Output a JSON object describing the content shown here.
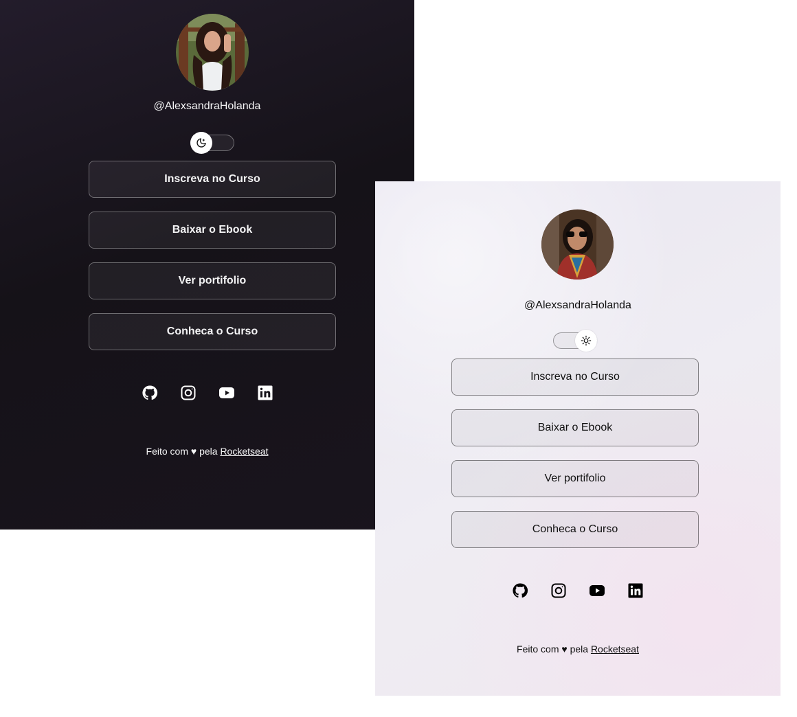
{
  "colors": {
    "dark_bg": "#151218",
    "light_bg": "#ecebf2",
    "dark_text": "#f4f4f5",
    "light_text": "#111111"
  },
  "dark": {
    "handle": "@AlexsandraHolanda",
    "theme_icon": "moon-icon",
    "links": [
      "Inscreva no Curso",
      "Baixar o Ebook",
      "Ver portifolio",
      "Conheca o Curso"
    ],
    "socials": [
      "github-icon",
      "instagram-icon",
      "youtube-icon",
      "linkedin-icon"
    ],
    "footer": {
      "prefix": "Feito com ♥ pela ",
      "link": "Rocketseat"
    }
  },
  "light": {
    "handle": "@AlexsandraHolanda",
    "theme_icon": "sun-icon",
    "links": [
      "Inscreva no Curso",
      "Baixar o Ebook",
      "Ver portifolio",
      "Conheca o Curso"
    ],
    "socials": [
      "github-icon",
      "instagram-icon",
      "youtube-icon",
      "linkedin-icon"
    ],
    "footer": {
      "prefix": "Feito com ♥ pela ",
      "link": "Rocketseat"
    }
  }
}
